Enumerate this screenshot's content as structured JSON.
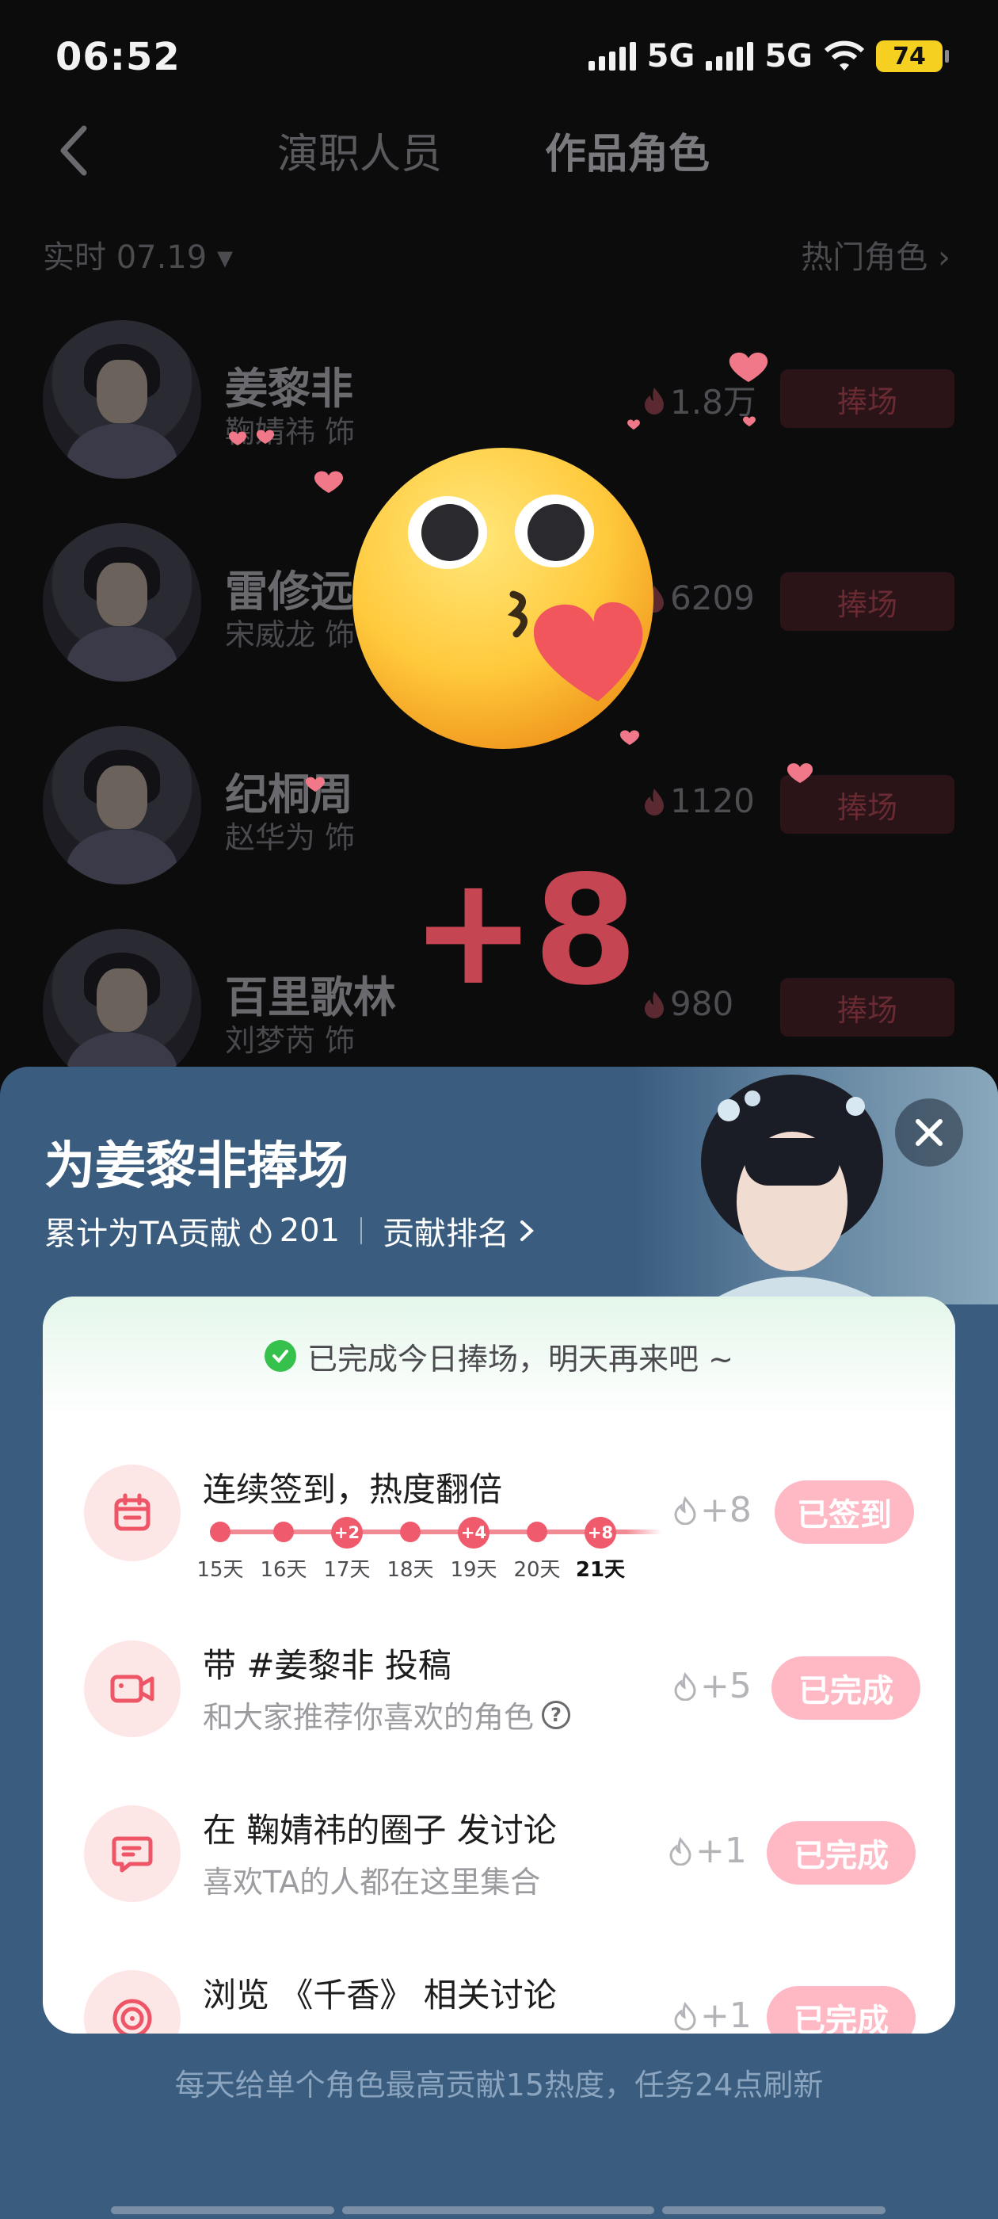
{
  "status_bar": {
    "time": "06:52",
    "network1": "5G",
    "network2": "5G",
    "battery": "74"
  },
  "header": {
    "tabs": [
      "演职人员",
      "作品角色"
    ],
    "active_tab": "作品角色"
  },
  "filters": {
    "date": "实时 07.19 ▾",
    "hot_roles": "热门角色 ›"
  },
  "characters": [
    {
      "name": "姜黎非",
      "actor": "鞠婧祎 饰",
      "heat": "1.8万",
      "button": "捧场"
    },
    {
      "name": "雷修远",
      "actor": "宋威龙 饰",
      "heat": "6209",
      "button": "捧场"
    },
    {
      "name": "纪桐周",
      "actor": "赵华为 饰",
      "heat": "1120",
      "button": "捧场"
    },
    {
      "name": "百里歌林",
      "actor": "刘梦芮 饰",
      "heat": "980",
      "button": "捧场"
    }
  ],
  "overlay": {
    "points": "+8"
  },
  "sheet": {
    "title": "为姜黎非捧场",
    "contribution_label": "累计为TA贡献",
    "contribution_value": "201",
    "ranking_link": "贡献排名",
    "done_notice": "已完成今日捧场，明天再来吧 ~",
    "tasks": [
      {
        "icon": "calendar-icon",
        "title": "连续签到，热度翻倍",
        "reward": "+8",
        "button": "已签到"
      },
      {
        "icon": "video-camera-icon",
        "title": "带 #姜黎非 投稿",
        "desc": "和大家推荐你喜欢的角色",
        "reward": "+5",
        "button": "已完成"
      },
      {
        "icon": "chat-bubble-icon",
        "title": "在 鞠婧祎的圈子 发讨论",
        "desc": "喜欢TA的人都在这里集合",
        "reward": "+1",
        "button": "已完成"
      },
      {
        "icon": "target-icon",
        "title": "浏览 《千香》 相关讨论",
        "desc": "",
        "reward": "+1",
        "button": "已完成"
      }
    ],
    "checkin_days": [
      {
        "label": "15天",
        "bonus": ""
      },
      {
        "label": "16天",
        "bonus": ""
      },
      {
        "label": "17天",
        "bonus": "+2"
      },
      {
        "label": "18天",
        "bonus": ""
      },
      {
        "label": "19天",
        "bonus": "+4"
      },
      {
        "label": "20天",
        "bonus": ""
      },
      {
        "label": "21天",
        "bonus": "+8"
      }
    ],
    "footer_note": "每天给单个角色最高贡献15热度，任务24点刷新"
  },
  "colors": {
    "sheet_bg": "#3a5c7e",
    "accent_pink": "#ef5a6c",
    "done_button": "#ffb9c5",
    "plus_text": "#c64553"
  }
}
